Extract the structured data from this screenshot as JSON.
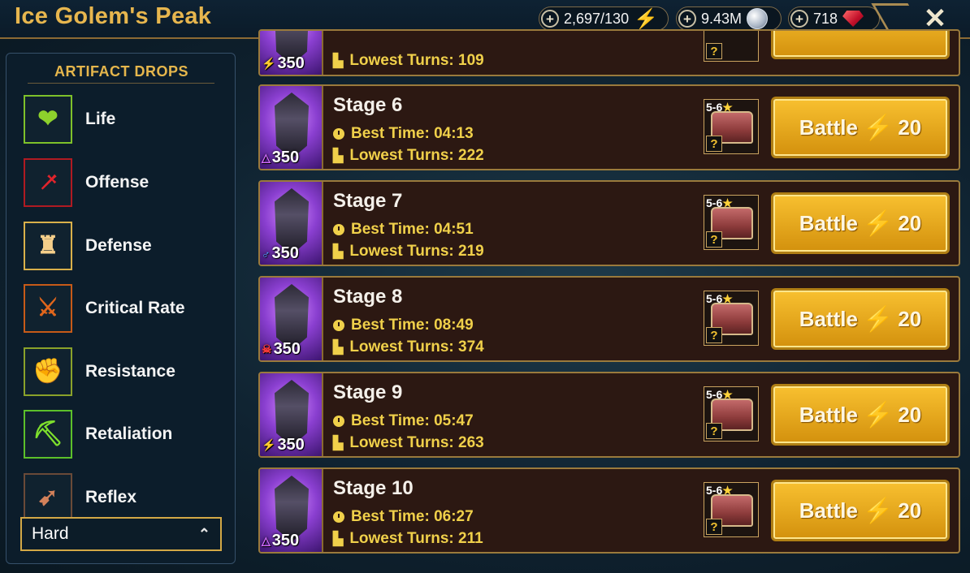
{
  "header": {
    "title": "Ice Golem's Peak",
    "resources": {
      "energy": "2,697/130",
      "silver": "9.43M",
      "gems": "718"
    },
    "plus_symbol": "+",
    "close_symbol": "✕"
  },
  "sidebar": {
    "title": "ARTIFACT DROPS",
    "filters": [
      {
        "label": "Life",
        "icon": "heart-icon",
        "color": "#8dd12c"
      },
      {
        "label": "Offense",
        "icon": "sword-icon",
        "color": "#e0242c"
      },
      {
        "label": "Defense",
        "icon": "tower-icon",
        "color": "#f5cf8a"
      },
      {
        "label": "Critical Rate",
        "icon": "crossed-swords-icon",
        "color": "#e0661c"
      },
      {
        "label": "Resistance",
        "icon": "fist-icon",
        "color": "#e8c13a"
      },
      {
        "label": "Retaliation",
        "icon": "pickaxe-icon",
        "color": "#7ee02c"
      },
      {
        "label": "Reflex",
        "icon": "arrow-icon",
        "color": "#d3815a"
      }
    ],
    "difficulty": "Hard"
  },
  "stages": [
    {
      "name": "",
      "best_time": "",
      "lowest_turns": "Lowest Turns: 109",
      "power": "350",
      "affinity": "⚡",
      "reward_stars": "",
      "battle_label": "",
      "energy_cost": ""
    },
    {
      "name": "Stage 6",
      "best_time": "Best Time: 04:13",
      "lowest_turns": "Lowest Turns: 222",
      "power": "350",
      "affinity": "△",
      "reward_stars": "5-6",
      "battle_label": "Battle",
      "energy_cost": "20"
    },
    {
      "name": "Stage 7",
      "best_time": "Best Time: 04:51",
      "lowest_turns": "Lowest Turns: 219",
      "power": "350",
      "affinity": "♂",
      "reward_stars": "5-6",
      "battle_label": "Battle",
      "energy_cost": "20"
    },
    {
      "name": "Stage 8",
      "best_time": "Best Time: 08:49",
      "lowest_turns": "Lowest Turns: 374",
      "power": "350",
      "affinity": "☠",
      "reward_stars": "5-6",
      "battle_label": "Battle",
      "energy_cost": "20"
    },
    {
      "name": "Stage 9",
      "best_time": "Best Time: 05:47",
      "lowest_turns": "Lowest Turns: 263",
      "power": "350",
      "affinity": "⚡",
      "reward_stars": "5-6",
      "battle_label": "Battle",
      "energy_cost": "20"
    },
    {
      "name": "Stage 10",
      "best_time": "Best Time: 06:27",
      "lowest_turns": "Lowest Turns: 211",
      "power": "350",
      "affinity": "△",
      "reward_stars": "5-6",
      "battle_label": "Battle",
      "energy_cost": "20"
    }
  ],
  "symbols": {
    "star": "★",
    "question": "?",
    "bolt": "⚡",
    "chevron_up": "⌃"
  },
  "colors": {
    "gold": "#e7b64e",
    "battle": "#f0b21f",
    "energy": "#c6f03c",
    "panel": "#2c1812"
  }
}
